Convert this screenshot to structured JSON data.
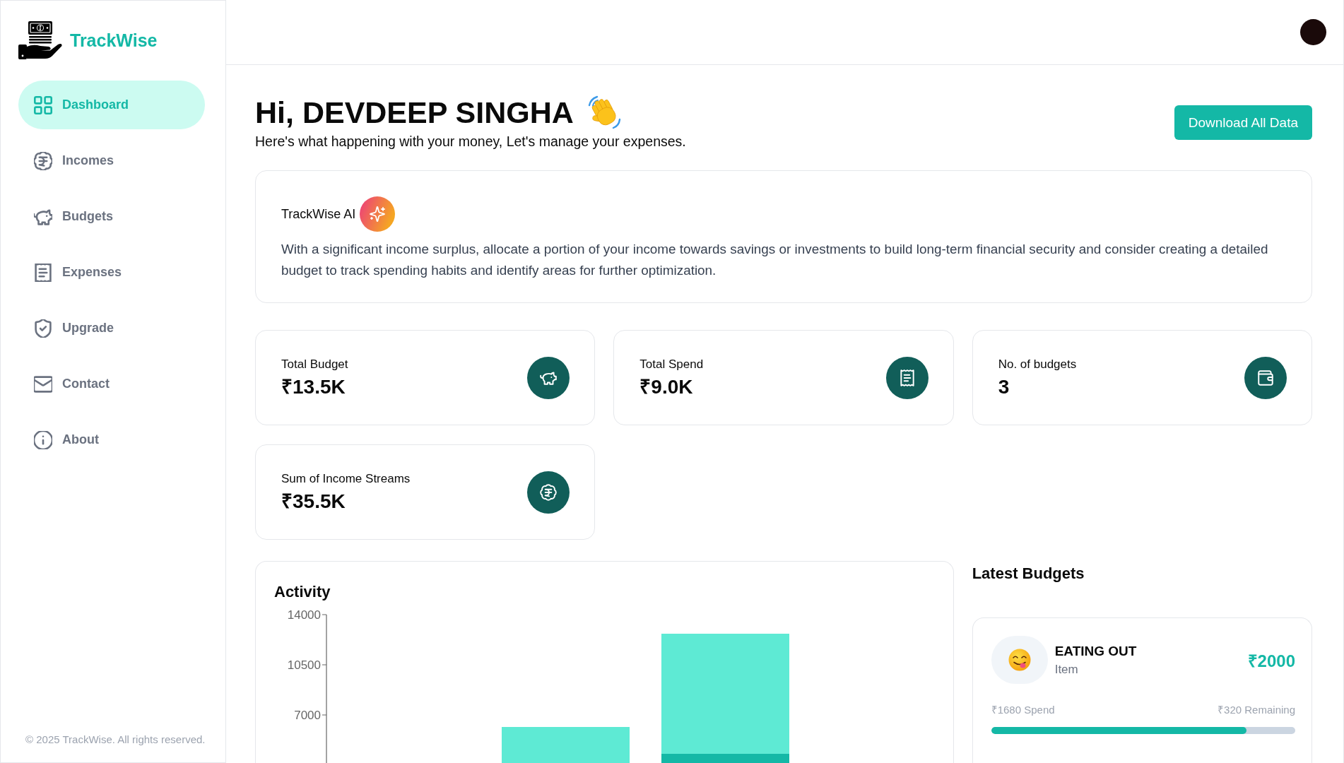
{
  "sidebar": {
    "brand": "TrackWise",
    "items": [
      {
        "label": "Dashboard",
        "selected": true
      },
      {
        "label": "Incomes",
        "selected": false
      },
      {
        "label": "Budgets",
        "selected": false
      },
      {
        "label": "Expenses",
        "selected": false
      },
      {
        "label": "Upgrade",
        "selected": false
      },
      {
        "label": "Contact",
        "selected": false
      },
      {
        "label": "About",
        "selected": false
      }
    ],
    "footer": "© 2025 TrackWise. All rights reserved."
  },
  "header": {
    "greeting": "Hi, DEVDEEP SINGHA",
    "subtitle": "Here's what happening with your money, Let's manage your expenses.",
    "download_button": "Download All Data"
  },
  "ai_insight": {
    "title": "TrackWise AI",
    "text": "With a significant income surplus, allocate a portion of your income towards savings or investments to build long-term financial security and consider creating a detailed budget to track spending habits and identify areas for further optimization."
  },
  "stats": [
    {
      "label": "Total Budget",
      "value": "₹13.5K"
    },
    {
      "label": "Total Spend",
      "value": "₹9.0K"
    },
    {
      "label": "No. of budgets",
      "value": "3"
    },
    {
      "label": "Sum of Income Streams",
      "value": "₹35.5K"
    }
  ],
  "activity": {
    "title": "Activity",
    "y_axis_labels": [
      "14000",
      "10500",
      "7000"
    ]
  },
  "latest_budgets": {
    "title": "Latest Budgets",
    "items": [
      {
        "name": "EATING OUT",
        "subtitle": "Item",
        "amount": "₹2000",
        "spend": "₹1680 Spend",
        "remaining": "₹320 Remaining",
        "level": 0.84
      }
    ]
  }
}
